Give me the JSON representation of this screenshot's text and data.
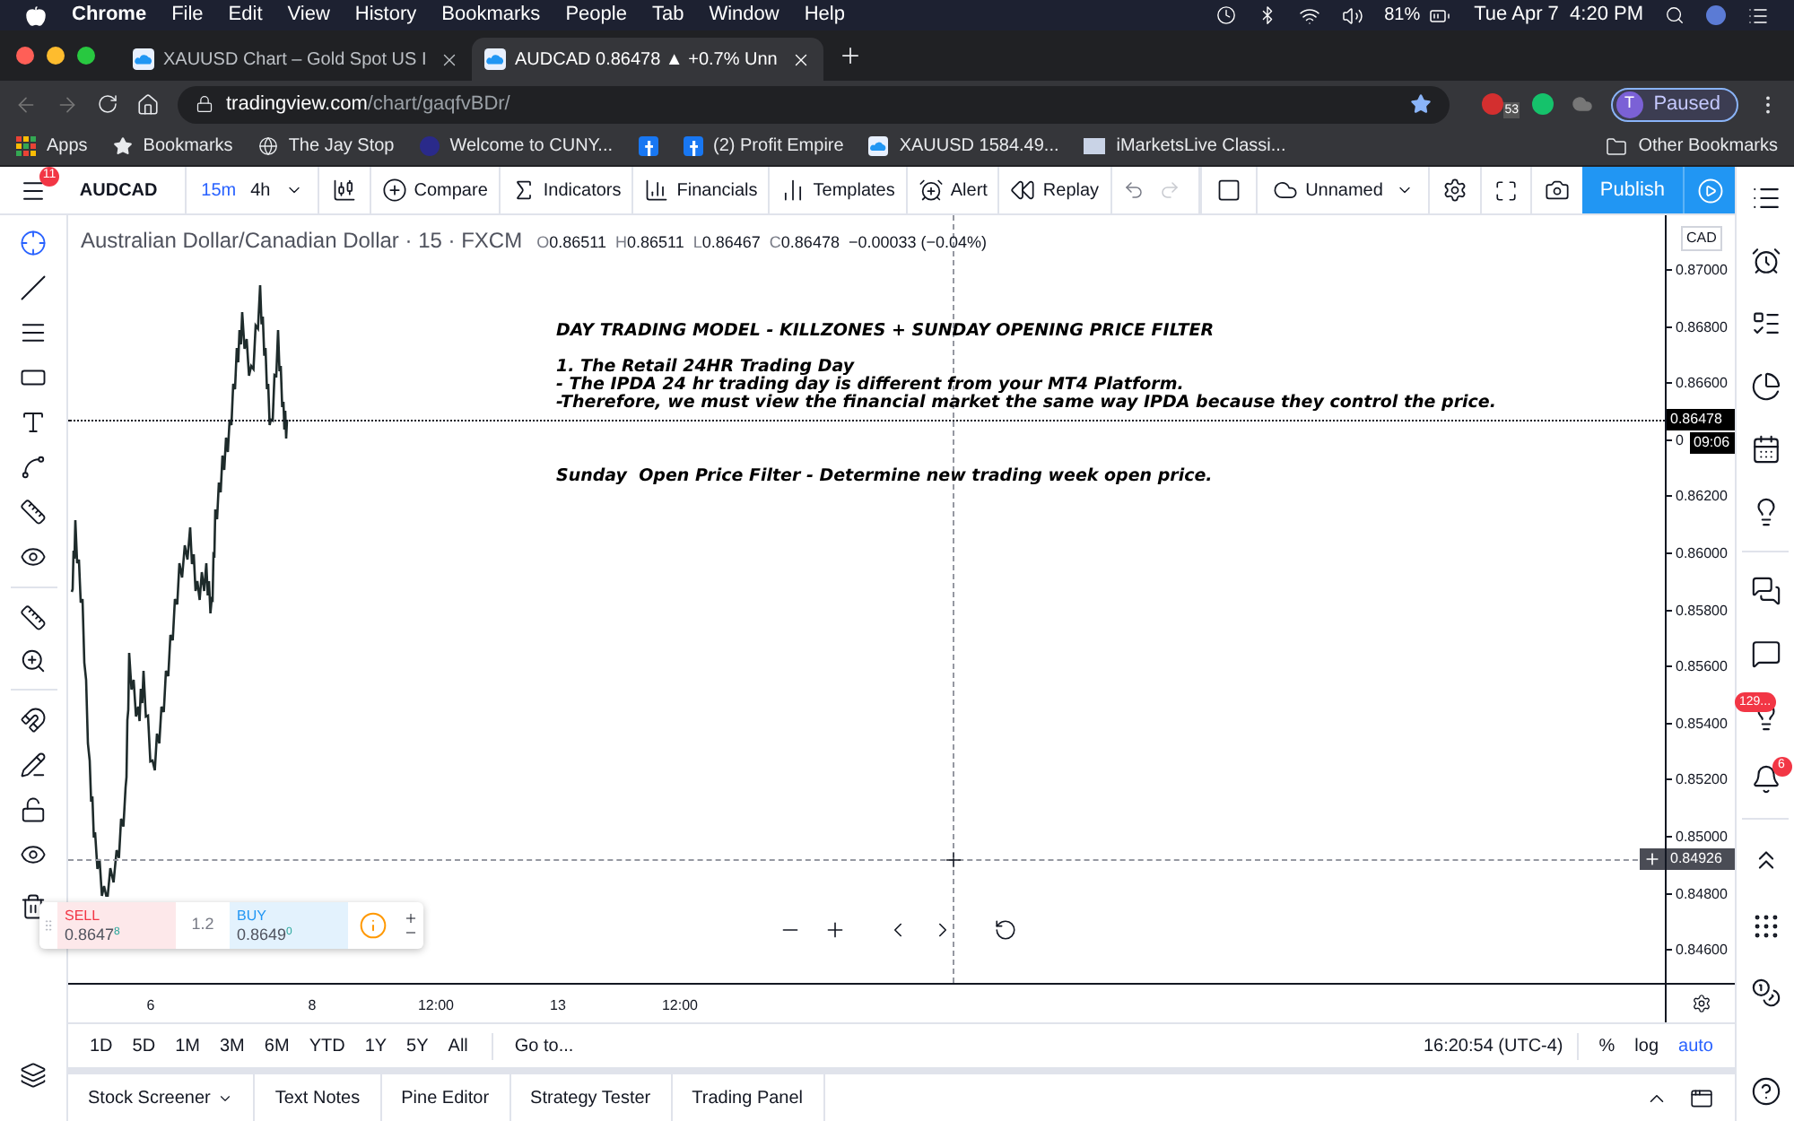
{
  "menubar": {
    "app": "Chrome",
    "menus": [
      "File",
      "Edit",
      "View",
      "History",
      "Bookmarks",
      "People",
      "Tab",
      "Window",
      "Help"
    ],
    "battery": "81%",
    "clock": "Tue Apr 7  4:20 PM"
  },
  "browser_tabs": [
    {
      "title": "XAUUSD Chart – Gold Spot US I",
      "selected": false
    },
    {
      "title": "AUDCAD 0.86478 ▲ +0.7% Unn",
      "selected": true
    }
  ],
  "address_bar": {
    "host": "tradingview.com",
    "path": "/chart/gaqfvBDr/",
    "extension_badge": "53",
    "profile_initial": "T",
    "profile_status": "Paused"
  },
  "bookmarks": [
    {
      "kind": "apps",
      "label": "Apps"
    },
    {
      "kind": "star",
      "label": "Bookmarks"
    },
    {
      "kind": "globe",
      "label": "The Jay Stop"
    },
    {
      "kind": "circle",
      "label": "Welcome to CUNY..."
    },
    {
      "kind": "facebook"
    },
    {
      "kind": "facebook",
      "label": "(2) Profit Empire"
    },
    {
      "kind": "tradingview",
      "label": "XAUUSD 1584.49..."
    },
    {
      "kind": "site",
      "label": "iMarketsLive Classi..."
    }
  ],
  "other_bookmarks": "Other Bookmarks",
  "toolbar": {
    "menu_badge": "11",
    "symbol": "AUDCAD",
    "intervals": [
      {
        "label": "15m",
        "selected": true
      },
      {
        "label": "4h",
        "selected": false
      }
    ],
    "buttons": [
      {
        "kind": "compare",
        "label": "Compare"
      },
      {
        "kind": "indicators",
        "label": "Indicators"
      },
      {
        "kind": "financials",
        "label": "Financials"
      },
      {
        "kind": "templates",
        "label": "Templates"
      },
      {
        "kind": "alert",
        "label": "Alert"
      },
      {
        "kind": "replay",
        "label": "Replay"
      }
    ],
    "layout_name": "Unnamed",
    "publish": "Publish"
  },
  "legend": {
    "title": "Australian Dollar/Canadian Dollar · 15 · FXCM",
    "ohlc": [
      {
        "key": "O",
        "value": "0.86511"
      },
      {
        "key": "H",
        "value": "0.86511"
      },
      {
        "key": "L",
        "value": "0.86467"
      },
      {
        "key": "C",
        "value": "0.86478"
      }
    ],
    "change": "−0.00033 (−0.04%)"
  },
  "annotations": [
    {
      "lines": [
        "DAY TRADING MODEL - KILLZONES + SUNDAY OPENING PRICE FILTER"
      ]
    },
    {
      "lines": [
        "1. The Retail 24HR Trading Day",
        "- The IPDA 24 hr trading day is different from your MT4 Platform.",
        "-Therefore, we must view the financial market the same way IPDA because they control the price."
      ]
    },
    {
      "lines": [
        "Sunday  Open Price Filter - Determine new trading week open price."
      ]
    }
  ],
  "trade_widget": {
    "sell_label": "SELL",
    "sell_price": "0.8647$^{8}$",
    "spread": "1.2",
    "buy_label": "BUY",
    "buy_price": "0.8649$^{0}$"
  },
  "price_axis": {
    "currency": "CAD",
    "labels": [
      "0.87000",
      "0.86800",
      "0.86600",
      "0",
      "0.86200",
      "0.86000",
      "0.85800",
      "0.85600",
      "0.85400",
      "0.85200",
      "0.85000",
      "0.84800",
      "0.84600"
    ],
    "last_price": "0.86478",
    "countdown": "09:06",
    "crosshair_price": "0.84926"
  },
  "time_axis": [
    "6",
    "8",
    "12:00",
    "13",
    "12:00"
  ],
  "ranges": [
    "1D",
    "5D",
    "1M",
    "3M",
    "6M",
    "YTD",
    "1Y",
    "5Y",
    "All"
  ],
  "goto": "Go to...",
  "clock": "16:20:54 (UTC-4)",
  "scale_options": [
    {
      "label": "%",
      "on": false
    },
    {
      "label": "log",
      "on": false
    },
    {
      "label": "auto",
      "on": true
    }
  ],
  "bottom_tabs": [
    {
      "label": "Stock Screener",
      "dropdown": true
    },
    {
      "label": "Text Notes",
      "dropdown": false
    },
    {
      "label": "Pine Editor",
      "dropdown": false
    },
    {
      "label": "Strategy Tester",
      "dropdown": false
    },
    {
      "label": "Trading Panel",
      "dropdown": false
    }
  ],
  "sidebar_badges": {
    "ideas": "129...",
    "alerts": "6"
  }
}
